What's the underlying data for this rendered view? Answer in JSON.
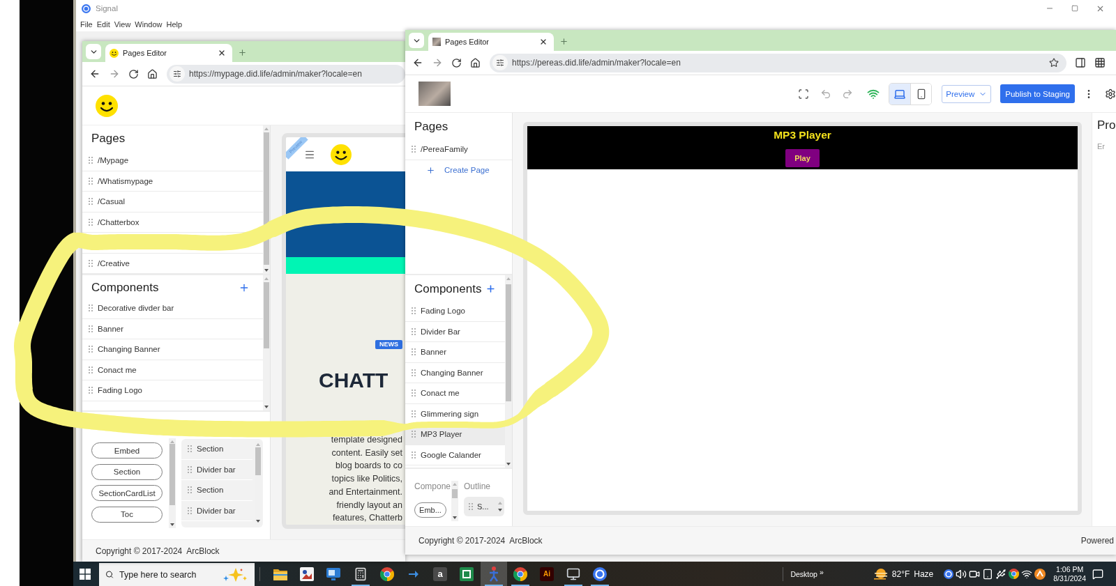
{
  "signal_window": {
    "title": "Signal",
    "menu": [
      "File",
      "Edit",
      "View",
      "Window",
      "Help"
    ]
  },
  "left_browser": {
    "tab": {
      "title": "Pages Editor"
    },
    "url": "https://mypage.did.life/admin/maker?locale=en",
    "pages": {
      "title": "Pages",
      "items": [
        {
          "kind": "page",
          "label": "/Mypage"
        },
        {
          "kind": "page",
          "label": "/Whatismypage"
        },
        {
          "kind": "page",
          "label": "/Casual"
        },
        {
          "kind": "page",
          "label": "/Chatterbox"
        },
        {
          "kind": "covered"
        },
        {
          "kind": "page",
          "label": "/Creative"
        }
      ]
    },
    "components": {
      "title": "Components",
      "items": [
        "Decorative divder bar",
        "Banner",
        "Changing Banner",
        "Conact me",
        "Fading Logo"
      ]
    },
    "library": {
      "blocks": [
        "Embed",
        "Section",
        "SectionCardList",
        "Toc"
      ],
      "outline": [
        "Section",
        "Divider bar",
        "Section",
        "Divider bar"
      ]
    },
    "preview": {
      "ribbon": "Preview",
      "badge": "NEWS",
      "heading": "CHATT",
      "lines": [
        "template designed",
        "content. Easily set",
        "blog boards to co",
        "topics like Politics,",
        "and Entertainment.",
        "friendly layout an",
        "features, Chatterb"
      ]
    },
    "footer": "Copyright © 2017-2024  ArcBlock"
  },
  "right_browser": {
    "tab": {
      "title": "Pages Editor"
    },
    "url": "https://pereas.did.life/admin/maker?locale=en",
    "toolbar": {
      "devices": [
        {
          "kind": "laptop",
          "selected": true
        },
        {
          "kind": "phone",
          "selected": false
        }
      ],
      "preview": "Preview",
      "publish": "Publish to Staging"
    },
    "pages": {
      "title": "Pages",
      "items": [
        "/PereaFamily"
      ],
      "create": "Create Page"
    },
    "components": {
      "title": "Components",
      "items": [
        {
          "label": "Fading Logo",
          "selected": false
        },
        {
          "label": "Divider Bar",
          "selected": false
        },
        {
          "label": "Banner",
          "selected": false
        },
        {
          "label": "Changing Banner",
          "selected": false
        },
        {
          "label": "Conact me",
          "selected": false
        },
        {
          "label": "Glimmering sign",
          "selected": false
        },
        {
          "label": "MP3 Player",
          "selected": true
        },
        {
          "label": "Google Calander",
          "selected": false
        }
      ]
    },
    "library": {
      "blocks_label": "Compone",
      "outline_label": "Outline",
      "blocks": [
        "Emb..."
      ],
      "outline": [
        "S..."
      ]
    },
    "canvas": {
      "title": "MP3 Player",
      "button": "Play"
    },
    "properties": {
      "title": "Pro",
      "hint": "Er"
    },
    "footer": {
      "copyright": "Copyright © 2017-2024  ArcBlock",
      "powered": "Powered"
    }
  },
  "taskbar": {
    "search": {
      "placeholder": "Type here to search"
    },
    "apps": [
      {
        "kind": "folder",
        "running": false,
        "selected": false
      },
      {
        "kind": "photos",
        "running": false,
        "selected": false
      },
      {
        "kind": "monitor",
        "running": false,
        "selected": false
      },
      {
        "kind": "calculator",
        "running": true,
        "selected": false
      },
      {
        "kind": "browser",
        "running": false,
        "selected": false
      },
      {
        "kind": "arrow",
        "running": false,
        "selected": false
      },
      {
        "kind": "store",
        "text": "a",
        "running": false,
        "selected": false
      },
      {
        "kind": "square",
        "running": false,
        "selected": false
      },
      {
        "kind": "figure",
        "running": true,
        "selected": true
      },
      {
        "kind": "browser",
        "running": true,
        "selected": false
      },
      {
        "kind": "design",
        "text": "Ai",
        "running": false,
        "selected": false
      },
      {
        "kind": "computer",
        "running": true,
        "selected": false
      },
      {
        "kind": "ring",
        "running": true,
        "selected": false
      }
    ],
    "desktop": "Desktop",
    "overflow": "»",
    "weather": {
      "temperature": "82°F",
      "condition": "Haze"
    },
    "clock": {
      "time": "1:06 PM",
      "date": "8/31/2024"
    }
  }
}
